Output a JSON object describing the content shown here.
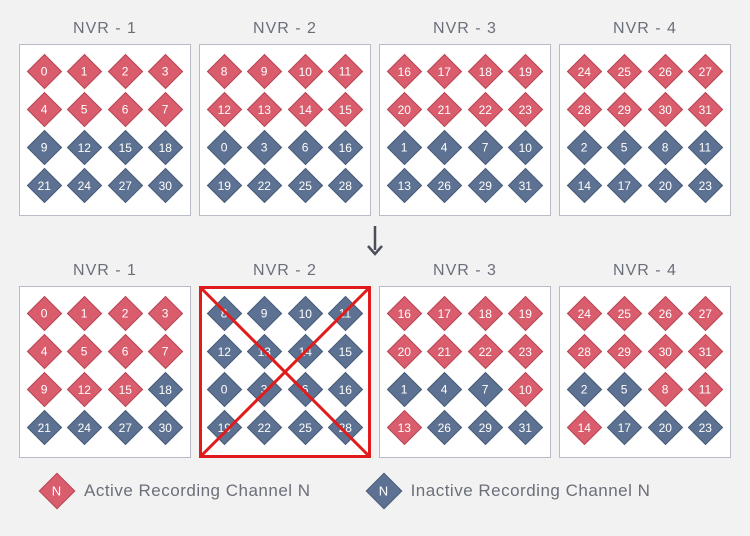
{
  "colors": {
    "active": "#d95d6c",
    "inactive": "#5d7292",
    "cross": "#e01b1b"
  },
  "legend": {
    "active": {
      "swatch": "N",
      "label": "Active Recording Channel N"
    },
    "inactive": {
      "swatch": "N",
      "label": "Inactive Recording Channel N"
    }
  },
  "rows": [
    {
      "nvrs": [
        {
          "title": "NVR - 1",
          "crossed": false,
          "cells": [
            {
              "n": 0,
              "s": "active"
            },
            {
              "n": 1,
              "s": "active"
            },
            {
              "n": 2,
              "s": "active"
            },
            {
              "n": 3,
              "s": "active"
            },
            {
              "n": 4,
              "s": "active"
            },
            {
              "n": 5,
              "s": "active"
            },
            {
              "n": 6,
              "s": "active"
            },
            {
              "n": 7,
              "s": "active"
            },
            {
              "n": 9,
              "s": "inactive"
            },
            {
              "n": 12,
              "s": "inactive"
            },
            {
              "n": 15,
              "s": "inactive"
            },
            {
              "n": 18,
              "s": "inactive"
            },
            {
              "n": 21,
              "s": "inactive"
            },
            {
              "n": 24,
              "s": "inactive"
            },
            {
              "n": 27,
              "s": "inactive"
            },
            {
              "n": 30,
              "s": "inactive"
            }
          ]
        },
        {
          "title": "NVR - 2",
          "crossed": false,
          "cells": [
            {
              "n": 8,
              "s": "active"
            },
            {
              "n": 9,
              "s": "active"
            },
            {
              "n": 10,
              "s": "active"
            },
            {
              "n": 11,
              "s": "active"
            },
            {
              "n": 12,
              "s": "active"
            },
            {
              "n": 13,
              "s": "active"
            },
            {
              "n": 14,
              "s": "active"
            },
            {
              "n": 15,
              "s": "active"
            },
            {
              "n": 0,
              "s": "inactive"
            },
            {
              "n": 3,
              "s": "inactive"
            },
            {
              "n": 6,
              "s": "inactive"
            },
            {
              "n": 16,
              "s": "inactive"
            },
            {
              "n": 19,
              "s": "inactive"
            },
            {
              "n": 22,
              "s": "inactive"
            },
            {
              "n": 25,
              "s": "inactive"
            },
            {
              "n": 28,
              "s": "inactive"
            }
          ]
        },
        {
          "title": "NVR - 3",
          "crossed": false,
          "cells": [
            {
              "n": 16,
              "s": "active"
            },
            {
              "n": 17,
              "s": "active"
            },
            {
              "n": 18,
              "s": "active"
            },
            {
              "n": 19,
              "s": "active"
            },
            {
              "n": 20,
              "s": "active"
            },
            {
              "n": 21,
              "s": "active"
            },
            {
              "n": 22,
              "s": "active"
            },
            {
              "n": 23,
              "s": "active"
            },
            {
              "n": 1,
              "s": "inactive"
            },
            {
              "n": 4,
              "s": "inactive"
            },
            {
              "n": 7,
              "s": "inactive"
            },
            {
              "n": 10,
              "s": "inactive"
            },
            {
              "n": 13,
              "s": "inactive"
            },
            {
              "n": 26,
              "s": "inactive"
            },
            {
              "n": 29,
              "s": "inactive"
            },
            {
              "n": 31,
              "s": "inactive"
            }
          ]
        },
        {
          "title": "NVR - 4",
          "crossed": false,
          "cells": [
            {
              "n": 24,
              "s": "active"
            },
            {
              "n": 25,
              "s": "active"
            },
            {
              "n": 26,
              "s": "active"
            },
            {
              "n": 27,
              "s": "active"
            },
            {
              "n": 28,
              "s": "active"
            },
            {
              "n": 29,
              "s": "active"
            },
            {
              "n": 30,
              "s": "active"
            },
            {
              "n": 31,
              "s": "active"
            },
            {
              "n": 2,
              "s": "inactive"
            },
            {
              "n": 5,
              "s": "inactive"
            },
            {
              "n": 8,
              "s": "inactive"
            },
            {
              "n": 11,
              "s": "inactive"
            },
            {
              "n": 14,
              "s": "inactive"
            },
            {
              "n": 17,
              "s": "inactive"
            },
            {
              "n": 20,
              "s": "inactive"
            },
            {
              "n": 23,
              "s": "inactive"
            }
          ]
        }
      ]
    },
    {
      "nvrs": [
        {
          "title": "NVR - 1",
          "crossed": false,
          "cells": [
            {
              "n": 0,
              "s": "active"
            },
            {
              "n": 1,
              "s": "active"
            },
            {
              "n": 2,
              "s": "active"
            },
            {
              "n": 3,
              "s": "active"
            },
            {
              "n": 4,
              "s": "active"
            },
            {
              "n": 5,
              "s": "active"
            },
            {
              "n": 6,
              "s": "active"
            },
            {
              "n": 7,
              "s": "active"
            },
            {
              "n": 9,
              "s": "active"
            },
            {
              "n": 12,
              "s": "active"
            },
            {
              "n": 15,
              "s": "active"
            },
            {
              "n": 18,
              "s": "inactive"
            },
            {
              "n": 21,
              "s": "inactive"
            },
            {
              "n": 24,
              "s": "inactive"
            },
            {
              "n": 27,
              "s": "inactive"
            },
            {
              "n": 30,
              "s": "inactive"
            }
          ]
        },
        {
          "title": "NVR - 2",
          "crossed": true,
          "cells": [
            {
              "n": 8,
              "s": "inactive"
            },
            {
              "n": 9,
              "s": "inactive"
            },
            {
              "n": 10,
              "s": "inactive"
            },
            {
              "n": 11,
              "s": "inactive"
            },
            {
              "n": 12,
              "s": "inactive"
            },
            {
              "n": 13,
              "s": "inactive"
            },
            {
              "n": 14,
              "s": "inactive"
            },
            {
              "n": 15,
              "s": "inactive"
            },
            {
              "n": 0,
              "s": "inactive"
            },
            {
              "n": 3,
              "s": "inactive"
            },
            {
              "n": 6,
              "s": "inactive"
            },
            {
              "n": 16,
              "s": "inactive"
            },
            {
              "n": 19,
              "s": "inactive"
            },
            {
              "n": 22,
              "s": "inactive"
            },
            {
              "n": 25,
              "s": "inactive"
            },
            {
              "n": 28,
              "s": "inactive"
            }
          ]
        },
        {
          "title": "NVR - 3",
          "crossed": false,
          "cells": [
            {
              "n": 16,
              "s": "active"
            },
            {
              "n": 17,
              "s": "active"
            },
            {
              "n": 18,
              "s": "active"
            },
            {
              "n": 19,
              "s": "active"
            },
            {
              "n": 20,
              "s": "active"
            },
            {
              "n": 21,
              "s": "active"
            },
            {
              "n": 22,
              "s": "active"
            },
            {
              "n": 23,
              "s": "active"
            },
            {
              "n": 1,
              "s": "inactive"
            },
            {
              "n": 4,
              "s": "inactive"
            },
            {
              "n": 7,
              "s": "inactive"
            },
            {
              "n": 10,
              "s": "active"
            },
            {
              "n": 13,
              "s": "active"
            },
            {
              "n": 26,
              "s": "inactive"
            },
            {
              "n": 29,
              "s": "inactive"
            },
            {
              "n": 31,
              "s": "inactive"
            }
          ]
        },
        {
          "title": "NVR - 4",
          "crossed": false,
          "cells": [
            {
              "n": 24,
              "s": "active"
            },
            {
              "n": 25,
              "s": "active"
            },
            {
              "n": 26,
              "s": "active"
            },
            {
              "n": 27,
              "s": "active"
            },
            {
              "n": 28,
              "s": "active"
            },
            {
              "n": 29,
              "s": "active"
            },
            {
              "n": 30,
              "s": "active"
            },
            {
              "n": 31,
              "s": "active"
            },
            {
              "n": 2,
              "s": "inactive"
            },
            {
              "n": 5,
              "s": "inactive"
            },
            {
              "n": 8,
              "s": "active"
            },
            {
              "n": 11,
              "s": "active"
            },
            {
              "n": 14,
              "s": "active"
            },
            {
              "n": 17,
              "s": "inactive"
            },
            {
              "n": 20,
              "s": "inactive"
            },
            {
              "n": 23,
              "s": "inactive"
            }
          ]
        }
      ]
    }
  ]
}
